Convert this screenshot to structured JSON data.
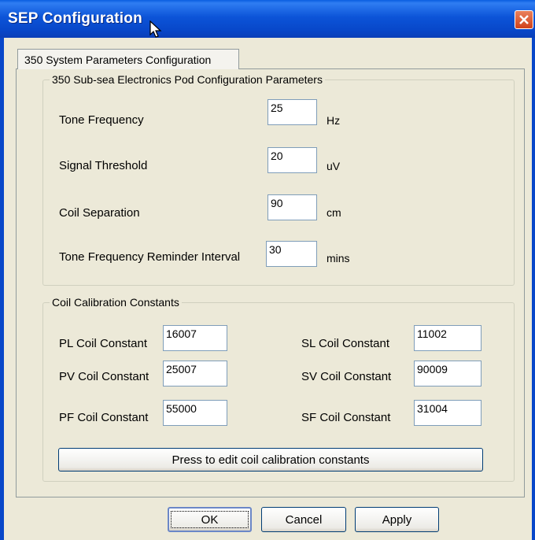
{
  "window": {
    "title": "SEP Configuration"
  },
  "tab": {
    "label": "350 System Parameters Configuration"
  },
  "pod_group": {
    "title": "350 Sub-sea Electronics Pod Configuration Parameters",
    "rows": [
      {
        "label": "Tone Frequency",
        "value": "25",
        "unit": "Hz"
      },
      {
        "label": "Signal Threshold",
        "value": "20",
        "unit": "uV"
      },
      {
        "label": "Coil Separation",
        "value": "90",
        "unit": "cm"
      },
      {
        "label": "Tone Frequency Reminder Interval",
        "value": "30",
        "unit": "mins"
      }
    ]
  },
  "coil_group": {
    "title": "Coil Calibration Constants",
    "left": [
      {
        "label": "PL Coil Constant",
        "value": "16007"
      },
      {
        "label": "PV Coil Constant",
        "value": "25007"
      },
      {
        "label": "PF Coil Constant",
        "value": "55000"
      }
    ],
    "right": [
      {
        "label": "SL Coil Constant",
        "value": "11002"
      },
      {
        "label": "SV Coil Constant",
        "value": "90009"
      },
      {
        "label": "SF Coil Constant",
        "value": "31004"
      }
    ],
    "edit_button": "Press to edit coil calibration constants"
  },
  "buttons": {
    "ok": "OK",
    "cancel": "Cancel",
    "apply": "Apply"
  },
  "icons": {
    "close": "close-icon",
    "cursor": "mouse-pointer-icon"
  }
}
